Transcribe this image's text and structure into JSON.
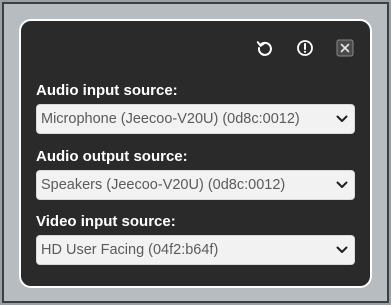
{
  "toolbar": {
    "icons": [
      "refresh-icon",
      "info-icon",
      "close-icon"
    ]
  },
  "fields": {
    "audio_input": {
      "label": "Audio input source:",
      "value": "Microphone (Jeecoo-V20U) (0d8c:0012)"
    },
    "audio_output": {
      "label": "Audio output source:",
      "value": "Speakers (Jeecoo-V20U) (0d8c:0012)"
    },
    "video_input": {
      "label": "Video input source:",
      "value": "HD User Facing (04f2:b64f)"
    }
  },
  "colors": {
    "dialog_bg": "#2a2a2a",
    "dialog_border": "#ffffff",
    "label_text": "#ffffff",
    "select_bg": "#f2f2f2",
    "select_text": "#5b5b5b"
  }
}
